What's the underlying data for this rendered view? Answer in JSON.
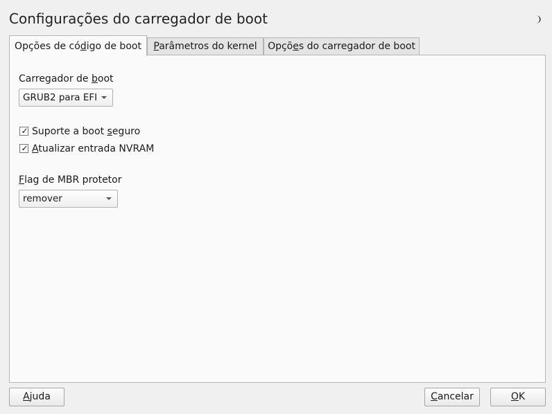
{
  "window": {
    "title": "Configurações do carregador de boot",
    "theme_icon": "moon-icon"
  },
  "tabs": [
    {
      "pre": "Opções de có",
      "u": "d",
      "post": "igo de boot",
      "active": true
    },
    {
      "pre": "",
      "u": "P",
      "post": "arâmetros do kernel",
      "active": false
    },
    {
      "pre": "Opçõ",
      "u": "e",
      "post": "s do carregador de boot",
      "active": false
    }
  ],
  "boot_code": {
    "loader_label_pre": "Carregador de ",
    "loader_label_u": "b",
    "loader_label_post": "oot",
    "loader_value": "GRUB2 para EFI",
    "secure_boot": {
      "pre": "Suporte a boot ",
      "u": "s",
      "post": "eguro",
      "checked": true,
      "mark": "✓"
    },
    "nvram": {
      "pre": "",
      "u": "A",
      "post": "tualizar entrada NVRAM",
      "checked": true,
      "mark": "✓"
    },
    "mbr_label_pre": "",
    "mbr_label_u": "F",
    "mbr_label_post": "lag de MBR protetor",
    "mbr_value": "remover"
  },
  "buttons": {
    "help": {
      "pre": "",
      "u": "A",
      "post": "juda"
    },
    "cancel": {
      "pre": "",
      "u": "C",
      "post": "ancelar"
    },
    "ok": {
      "pre": "",
      "u": "O",
      "post": "K"
    }
  },
  "colors": {
    "background": "#f0f0f0",
    "panel": "#fafafa",
    "border": "#b4b4b4"
  }
}
